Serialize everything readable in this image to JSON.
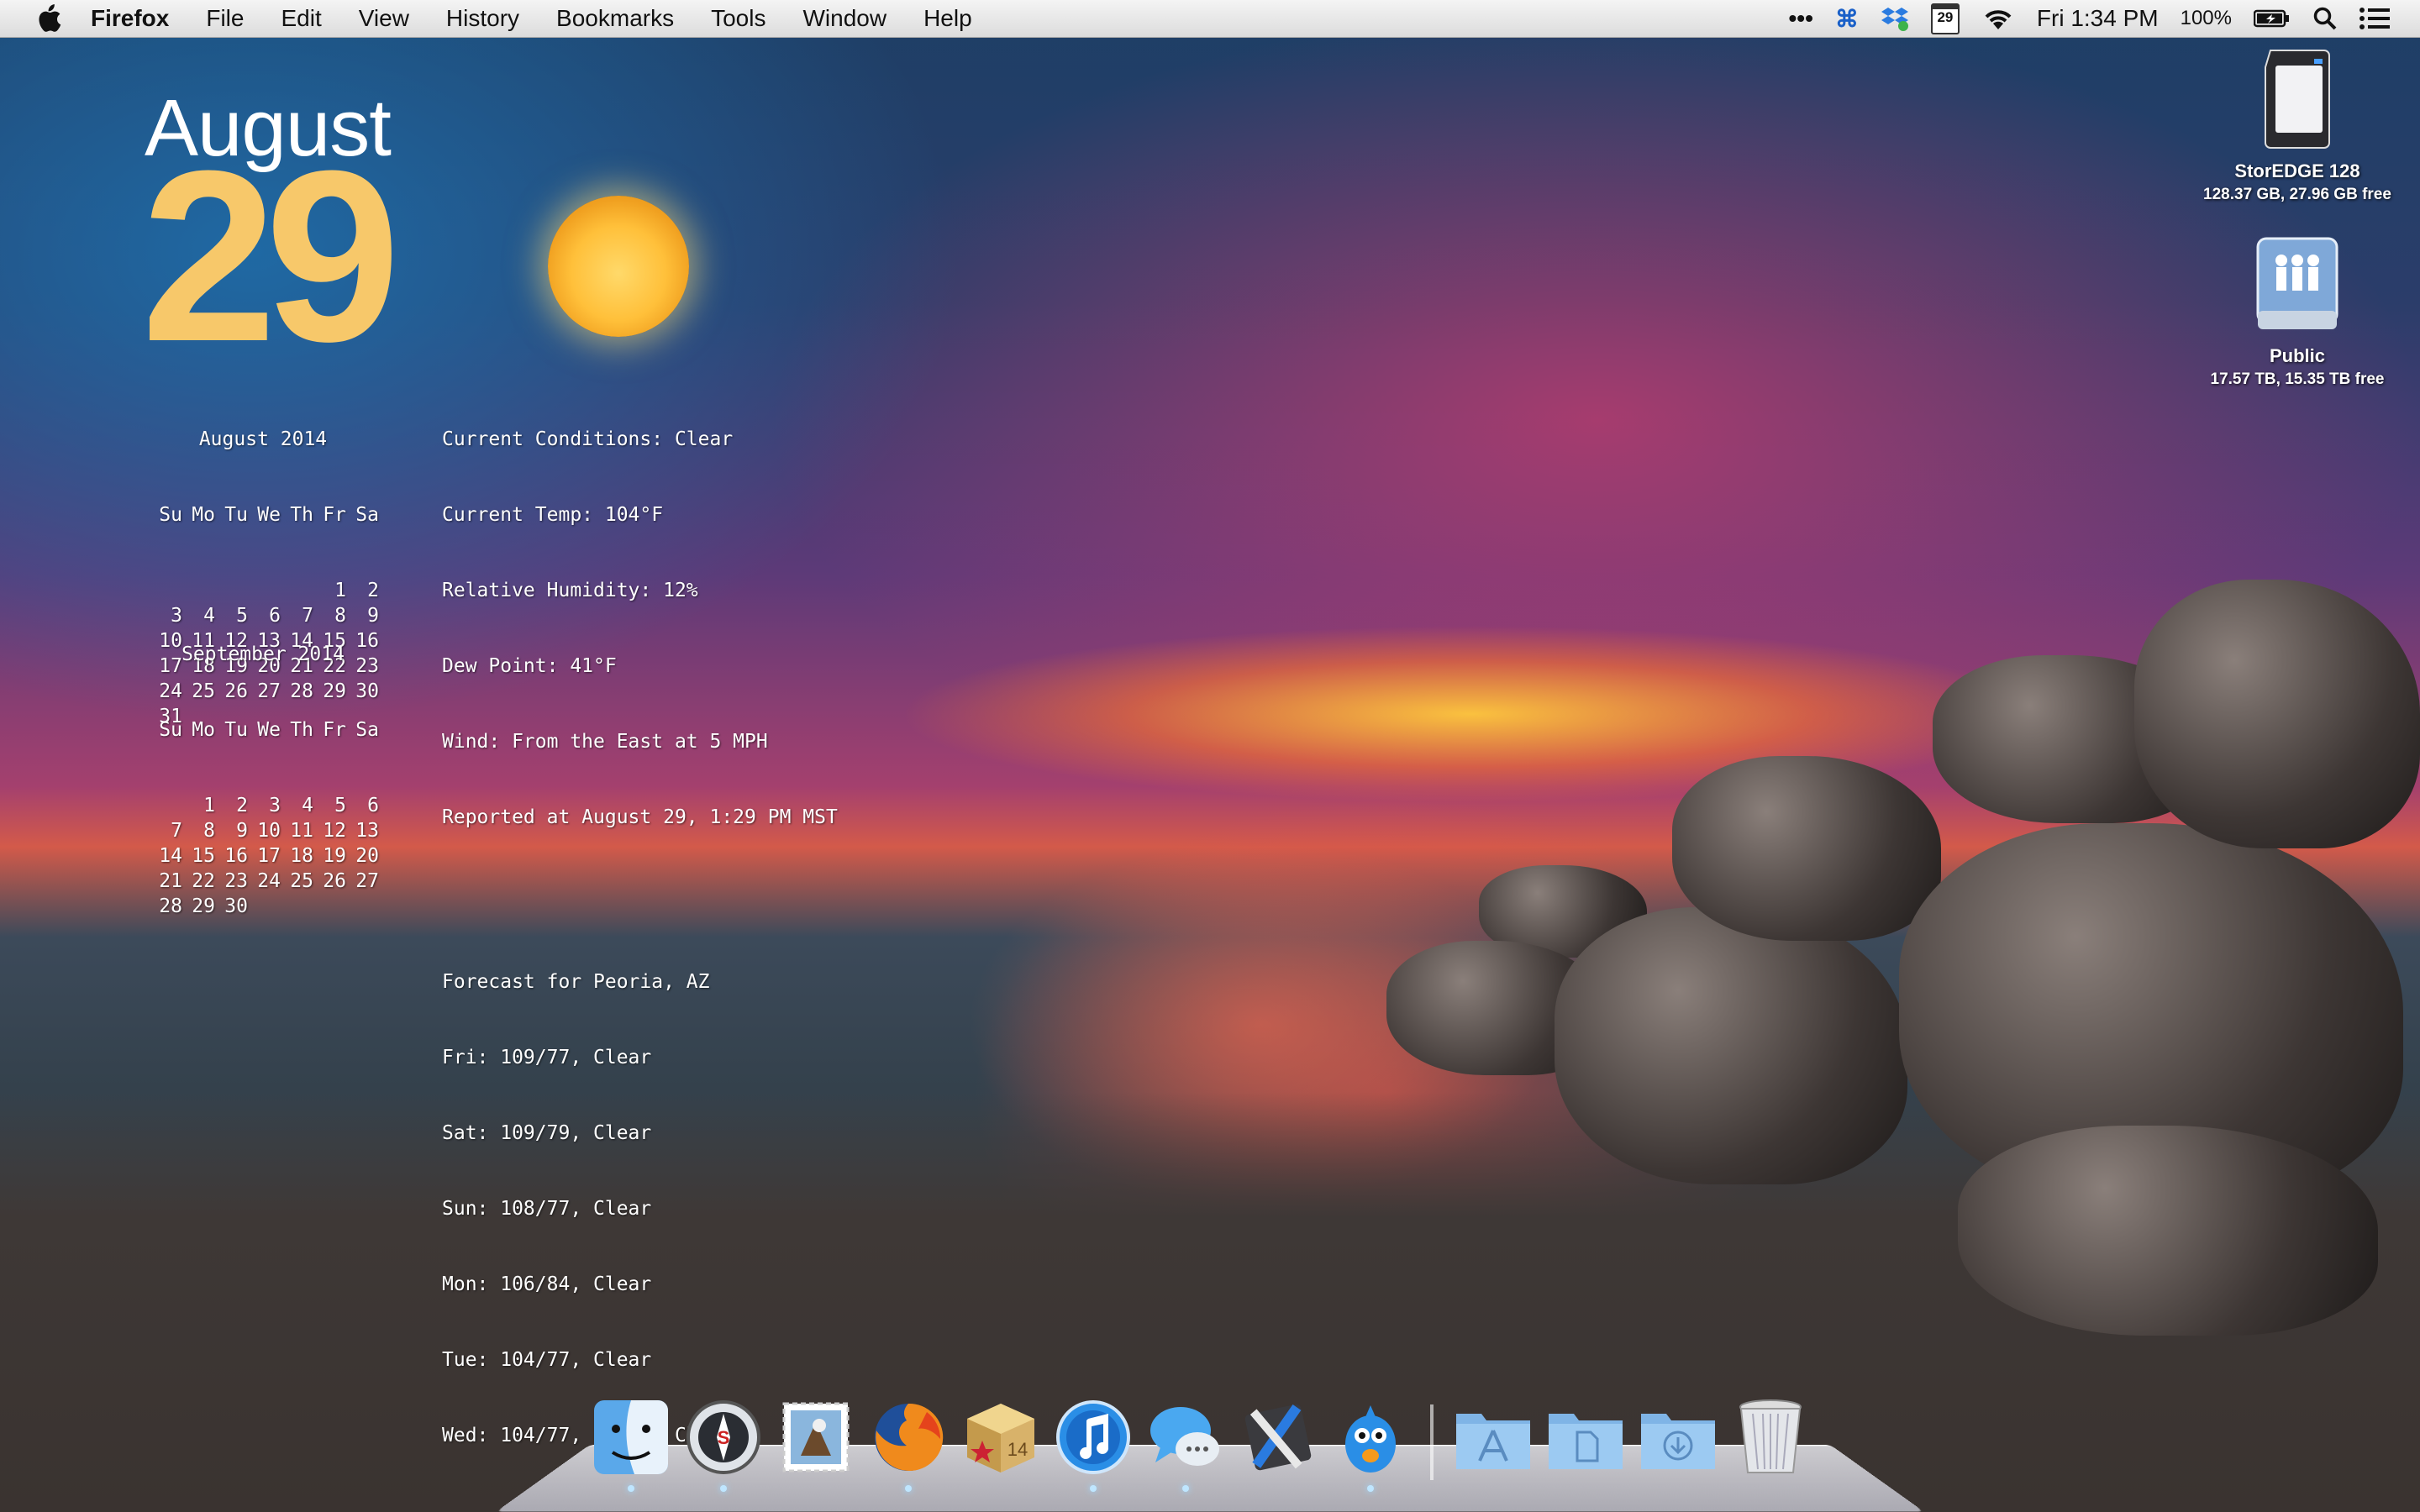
{
  "menubar": {
    "app_name": "Firefox",
    "menus": [
      "File",
      "Edit",
      "View",
      "History",
      "Bookmarks",
      "Tools",
      "Window",
      "Help"
    ],
    "status": {
      "more": "•••",
      "cmd": "⌘",
      "calendar_day": "29",
      "clock": "Fri 1:34 PM",
      "battery": "100%"
    }
  },
  "date_widget": {
    "month": "August",
    "day": "29"
  },
  "calendars": [
    {
      "title": "August 2014",
      "weekdays": [
        "Su",
        "Mo",
        "Tu",
        "We",
        "Th",
        "Fr",
        "Sa"
      ],
      "weeks": [
        [
          "",
          "",
          "",
          "",
          "",
          "1",
          "2"
        ],
        [
          "3",
          "4",
          "5",
          "6",
          "7",
          "8",
          "9"
        ],
        [
          "10",
          "11",
          "12",
          "13",
          "14",
          "15",
          "16"
        ],
        [
          "17",
          "18",
          "19",
          "20",
          "21",
          "22",
          "23"
        ],
        [
          "24",
          "25",
          "26",
          "27",
          "28",
          "29",
          "30"
        ],
        [
          "31",
          "",
          "",
          "",
          "",
          "",
          ""
        ]
      ]
    },
    {
      "title": "September 2014",
      "weekdays": [
        "Su",
        "Mo",
        "Tu",
        "We",
        "Th",
        "Fr",
        "Sa"
      ],
      "weeks": [
        [
          "",
          "1",
          "2",
          "3",
          "4",
          "5",
          "6"
        ],
        [
          "7",
          "8",
          "9",
          "10",
          "11",
          "12",
          "13"
        ],
        [
          "14",
          "15",
          "16",
          "17",
          "18",
          "19",
          "20"
        ],
        [
          "21",
          "22",
          "23",
          "24",
          "25",
          "26",
          "27"
        ],
        [
          "28",
          "29",
          "30",
          "",
          "",
          "",
          ""
        ]
      ]
    }
  ],
  "weather": {
    "current": [
      "Current Conditions: Clear",
      "Current Temp: 104°F",
      "Relative Humidity: 12%",
      "Dew Point: 41°F",
      "Wind: From the East at 5 MPH",
      "Reported at August 29, 1:29 PM MST"
    ],
    "forecast_title": "Forecast for Peoria, AZ",
    "forecast": [
      "Fri: 109/77, Clear",
      "Sat: 109/79, Clear",
      "Sun: 108/77, Clear",
      "Mon: 106/84, Clear",
      "Tue: 104/77, Clear",
      "Wed: 104/77, Partly Cloudy"
    ]
  },
  "desktop_icons": [
    {
      "name": "StorEDGE 128",
      "info": "128.37 GB, 27.96 GB free",
      "icon": "sd-card-icon"
    },
    {
      "name": "Public",
      "info": "17.57 TB, 15.35 TB free",
      "icon": "network-drive-icon"
    }
  ],
  "dock": {
    "apps": [
      "Finder",
      "Safari-like",
      "Mail",
      "Firefox",
      "Package",
      "iTunes",
      "Messages",
      "Utilities",
      "Tweetbot"
    ],
    "stacks": [
      "Applications",
      "Documents",
      "Downloads"
    ],
    "trash": "Trash",
    "badge_14": "14"
  }
}
